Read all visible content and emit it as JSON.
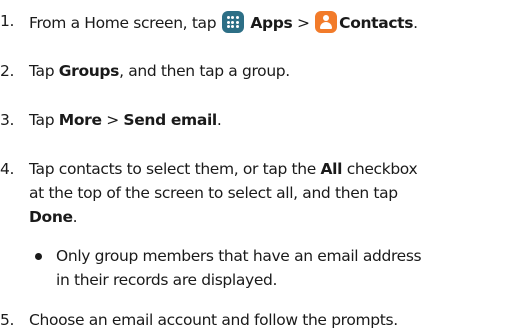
{
  "steps": [
    {
      "num": "1.",
      "t1": "From a Home screen, tap",
      "apps_label": "Apps",
      "sep": ">",
      "contacts_label": "Contacts",
      "end": "."
    },
    {
      "num": "2.",
      "t1": "Tap",
      "groups_label": "Groups",
      "t2": ", and then tap a group."
    },
    {
      "num": "3.",
      "t1": "Tap",
      "more_label": "More",
      "sep": ">",
      "send_email_label": "Send email",
      "end": "."
    },
    {
      "num": "4.",
      "line1_pre": "Tap contacts to select them, or tap the",
      "all_label": "All",
      "line1_post": "checkbox",
      "line2": "at the top of the screen to select all, and then tap",
      "done_label": "Done",
      "end": "."
    },
    {
      "num": "5.",
      "text": "Choose an email account and follow the prompts."
    }
  ],
  "note": {
    "line1": "Only group members that have an email address",
    "line2": "in their records are displayed."
  },
  "icons": {
    "apps": "apps-grid-icon",
    "contacts": "contacts-person-icon",
    "apps_color": "#2d6f86",
    "contacts_color": "#f27b2a"
  }
}
